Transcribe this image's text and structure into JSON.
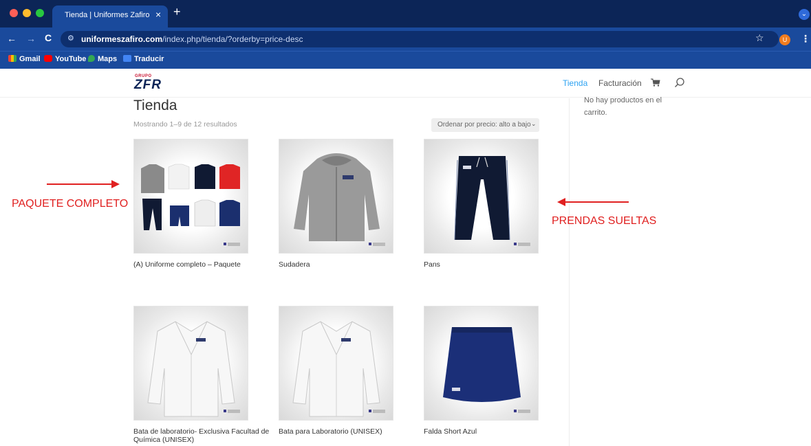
{
  "browser": {
    "tab_title": "Tienda | Uniformes Zafiro",
    "url_host": "uniformeszafiro.com",
    "url_path": "/index.php/tienda/?orderby=price-desc",
    "profile_initial": "U",
    "bookmarks": [
      "Gmail",
      "YouTube",
      "Maps",
      "Traducir"
    ]
  },
  "site": {
    "logo_top": "GRUPO",
    "logo_main": "ZFR",
    "nav": {
      "tienda": "Tienda",
      "facturacion": "Facturación"
    },
    "accent_color": "#2ea3f2"
  },
  "shop": {
    "title": "Tienda",
    "result_count": "Mostrando 1–9 de 12 resultados",
    "orderby_selected": "Ordenar por precio: alto a bajo",
    "products": [
      {
        "name": "(A) Uniforme completo – Paquete"
      },
      {
        "name": "Sudadera"
      },
      {
        "name": "Pans"
      },
      {
        "name": "Bata de laboratorio- Exclusiva Facultad de Química (UNISEX)"
      },
      {
        "name": "Bata para Laboratorio (UNISEX)"
      },
      {
        "name": "Falda Short Azul"
      }
    ]
  },
  "sidebar": {
    "cart_empty": "No hay productos en el carrito."
  },
  "annotations": {
    "left": "PAQUETE COMPLETO",
    "right": "PRENDAS SUELTAS",
    "color": "#e02020"
  }
}
